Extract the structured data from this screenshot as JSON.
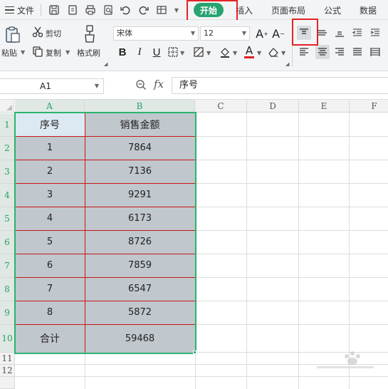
{
  "menu": {
    "file_label": "文件",
    "tabs": [
      "开始",
      "插入",
      "页面布局",
      "公式",
      "数据"
    ],
    "active_tab": "开始",
    "highlight_color": "#e42323",
    "active_color": "#28a36f"
  },
  "ribbon": {
    "paste_label": "粘贴",
    "cut_label": "剪切",
    "copy_label": "复制",
    "format_painter_label": "格式刷",
    "font_name": "宋体",
    "font_size": "12",
    "bold_label": "B",
    "italic_label": "I",
    "underline_label": "U",
    "font_color_label": "A",
    "grow_font_label": "A",
    "shrink_font_label": "A",
    "active_alignment": "top-align"
  },
  "formula_bar": {
    "cell_ref": "A1",
    "fx_label": "fx",
    "content": "序号"
  },
  "sheet": {
    "columns": [
      "A",
      "B",
      "C",
      "D",
      "E",
      "F"
    ],
    "rows": [
      "1",
      "2",
      "3",
      "4",
      "5",
      "6",
      "7",
      "8",
      "9",
      "10",
      "11",
      "12"
    ],
    "selected_columns": [
      "A",
      "B"
    ],
    "selected_rows_count": 10,
    "table": {
      "header": [
        "序号",
        "销售金额"
      ],
      "rows": [
        [
          "1",
          "7864"
        ],
        [
          "2",
          "7136"
        ],
        [
          "3",
          "9291"
        ],
        [
          "4",
          "6173"
        ],
        [
          "5",
          "8726"
        ],
        [
          "6",
          "7859"
        ],
        [
          "7",
          "6547"
        ],
        [
          "8",
          "5872"
        ],
        [
          "合计",
          "59468"
        ]
      ]
    },
    "colors": {
      "table_fill": "#c0c7cd",
      "header_a_fill": "#dce9f3",
      "inner_border": "#c81818",
      "selection": "#2cb36f"
    }
  }
}
